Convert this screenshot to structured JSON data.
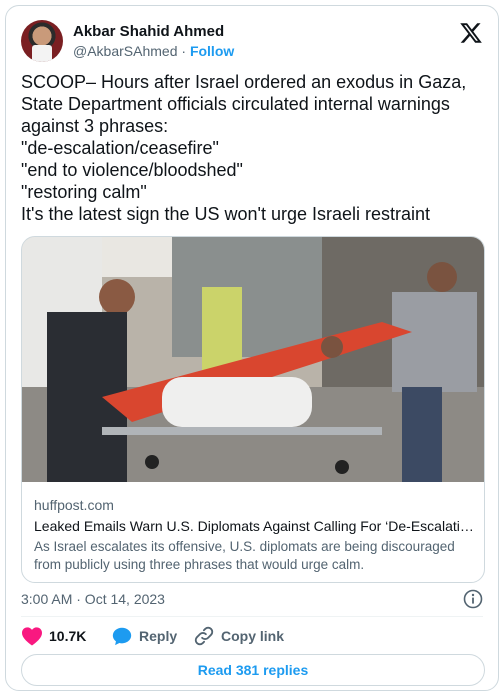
{
  "author": {
    "name": "Akbar Shahid Ahmed",
    "handle": "@AkbarSAhmed",
    "separator": "·",
    "follow_label": "Follow"
  },
  "tweet": {
    "text": "SCOOP– Hours after Israel ordered an exodus in Gaza,\nState Department officials circulated internal warnings\nagainst 3 phrases:\n\"de-escalation/ceasefire\"\n\"end to violence/bloodshed\"\n\"restoring calm\"\nIt's the latest sign the US won't urge Israeli restraint"
  },
  "link_card": {
    "domain": "huffpost.com",
    "title": "Leaked Emails Warn U.S. Diplomats Against Calling For ‘De-Escalation’ In Israel-Hamas War",
    "description": "As Israel escalates its offensive, U.S. diplomats are being discouraged from publicly using three phrases that would urge calm."
  },
  "meta": {
    "timestamp": "3:00 AM · Oct 14, 2023"
  },
  "actions": {
    "like_count": "10.7K",
    "reply_label": "Reply",
    "copy_link_label": "Copy link",
    "read_replies_label": "Read 381 replies"
  },
  "colors": {
    "accent": "#1d9bf0",
    "like": "#f91880",
    "text": "#0f1419",
    "secondary": "#536471",
    "border": "#cfd9de"
  },
  "icons": [
    "x-logo-icon",
    "info-icon",
    "heart-icon",
    "reply-bubble-icon",
    "link-icon"
  ]
}
